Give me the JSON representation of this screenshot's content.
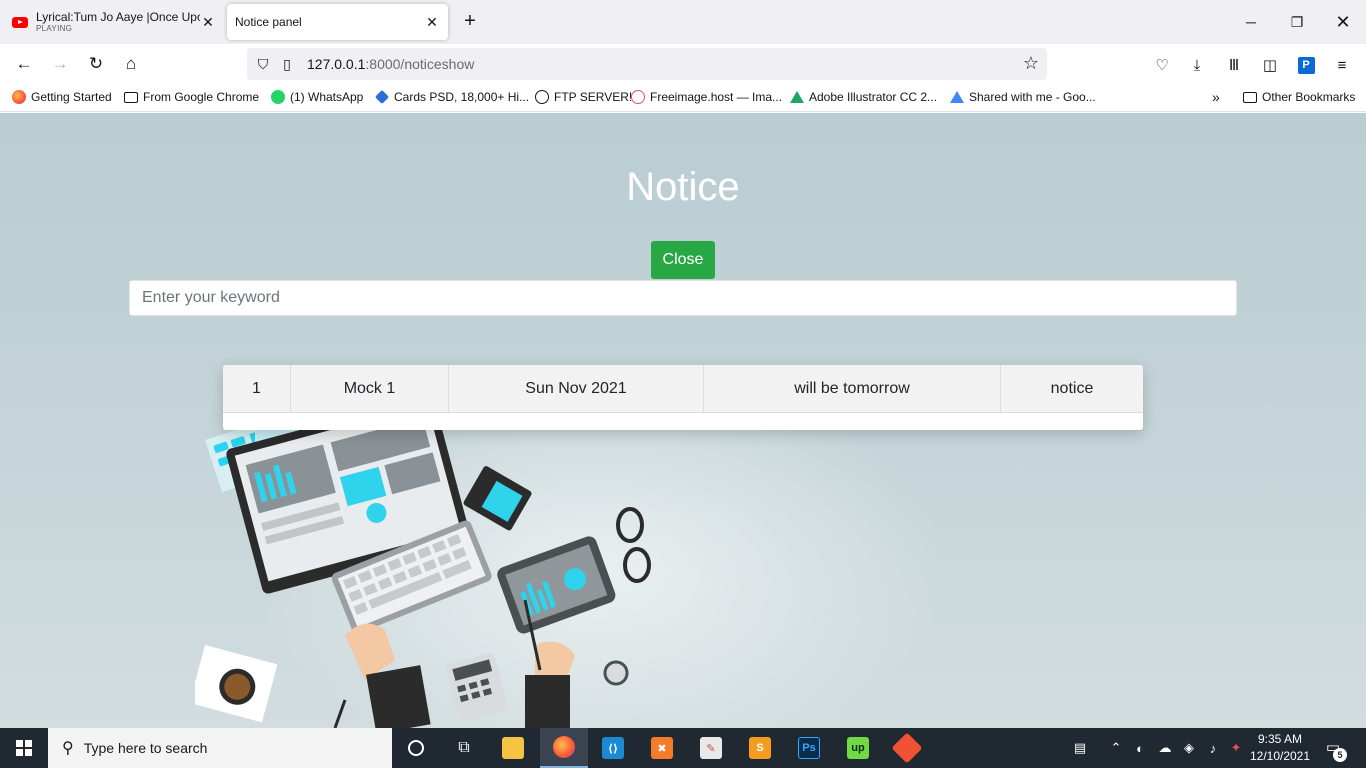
{
  "browser": {
    "tabs": [
      {
        "title": "Lyrical:Tum Jo Aaye |Once Upon",
        "subtitle": "PLAYING",
        "active": false
      },
      {
        "title": "Notice panel",
        "subtitle": "",
        "active": true
      }
    ],
    "url": {
      "host": "127.0.0.1",
      "path": ":8000/noticeshow"
    },
    "bookmarks": [
      "Getting Started",
      "From Google Chrome",
      "(1) WhatsApp",
      "Cards PSD, 18,000+ Hi...",
      "FTP SERVER!",
      "Freeimage.host — Ima...",
      "Adobe Illustrator CC 2...",
      "Shared with me - Goo..."
    ],
    "other_bookmarks": "Other Bookmarks"
  },
  "page": {
    "title": "Notice",
    "close_label": "Close",
    "search_placeholder": "Enter your keyword",
    "notices": [
      {
        "id": "1",
        "title": "Mock 1",
        "date": "Sun Nov 2021",
        "description": "will be tomorrow",
        "type": "notice"
      }
    ]
  },
  "taskbar": {
    "search_placeholder": "Type here to search",
    "time": "9:35 AM",
    "date": "12/10/2021",
    "notification_count": "5"
  },
  "colors": {
    "close_button": "#28a745",
    "page_background": "#bfd0d4",
    "taskbar": "#202831"
  }
}
